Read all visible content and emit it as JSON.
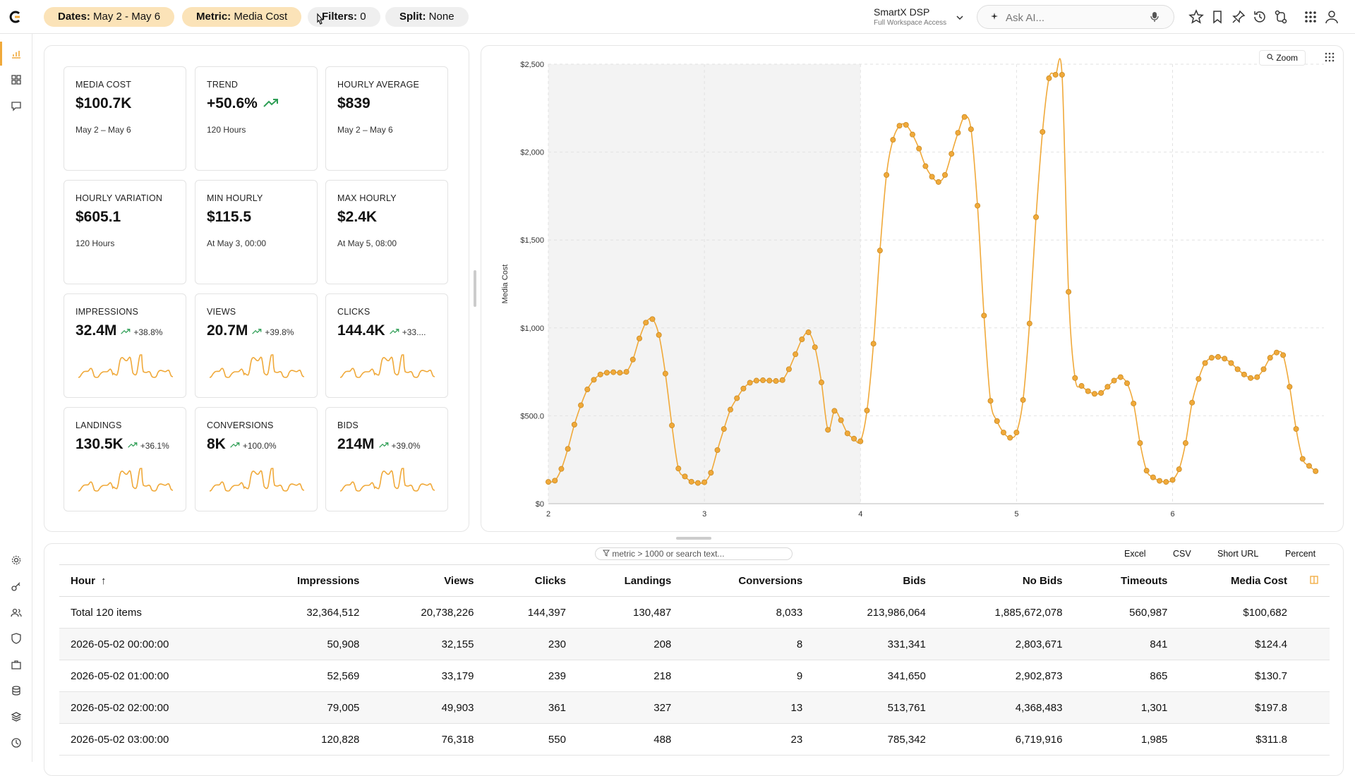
{
  "toolbar": {
    "dates_label": "Dates:",
    "dates_value": "May 2 - May 6",
    "metric_label": "Metric:",
    "metric_value": "Media Cost",
    "filters_label": "Filters:",
    "filters_value": "0",
    "split_label": "Split:",
    "split_value": "None"
  },
  "workspace": {
    "name": "SmartX DSP",
    "access": "Full Workspace Access"
  },
  "ask": {
    "placeholder": "Ask AI..."
  },
  "cards": [
    {
      "label": "MEDIA COST",
      "value": "$100.7K",
      "sub": "May 2 – May 6"
    },
    {
      "label": "TREND",
      "value": "+50.6%",
      "sub": "120 Hours"
    },
    {
      "label": "HOURLY AVERAGE",
      "value": "$839",
      "sub": "May 2 – May 6"
    },
    {
      "label": "HOURLY VARIATION",
      "value": "$605.1",
      "sub": "120 Hours"
    },
    {
      "label": "MIN HOURLY",
      "value": "$115.5",
      "sub": "At May 3, 00:00"
    },
    {
      "label": "MAX HOURLY",
      "value": "$2.4K",
      "sub": "At May 5, 08:00"
    },
    {
      "label": "IMPRESSIONS",
      "value": "32.4M",
      "change": "+38.8%"
    },
    {
      "label": "VIEWS",
      "value": "20.7M",
      "change": "+39.8%"
    },
    {
      "label": "CLICKS",
      "value": "144.4K",
      "change": "+33...."
    },
    {
      "label": "LANDINGS",
      "value": "130.5K",
      "change": "+36.1%"
    },
    {
      "label": "CONVERSIONS",
      "value": "8K",
      "change": "+100.0%"
    },
    {
      "label": "BIDS",
      "value": "214M",
      "change": "+39.0%"
    }
  ],
  "chart_zoom": "Zoom",
  "chart_data": {
    "type": "line",
    "ylabel": "Media Cost",
    "ylim": [
      0,
      2500
    ],
    "yticks": [
      "$0",
      "$500.0",
      "$1,000",
      "$1,500",
      "$2,000",
      "$2,500"
    ],
    "xticks": [
      "2",
      "3",
      "4",
      "5",
      "6"
    ],
    "xlim": [
      2,
      6.97
    ],
    "shaded_range": [
      2,
      4
    ],
    "color": "#f0a93a",
    "series": [
      {
        "values": [
          124,
          131,
          198,
          312,
          450,
          560,
          650,
          705,
          735,
          745,
          748,
          745,
          750,
          820,
          940,
          1030,
          1050,
          960,
          740,
          445,
          200,
          155,
          125,
          118,
          122,
          176,
          305,
          425,
          535,
          600,
          655,
          688,
          700,
          702,
          700,
          698,
          703,
          765,
          850,
          935,
          975,
          890,
          690,
          420,
          528,
          475,
          400,
          370,
          355,
          530,
          910,
          1440,
          1870,
          2070,
          2150,
          2155,
          2100,
          2020,
          1920,
          1860,
          1830,
          1870,
          1990,
          2110,
          2200,
          2130,
          1695,
          1070,
          585,
          470,
          405,
          375,
          405,
          590,
          1025,
          1630,
          2115,
          2420,
          2440,
          2440,
          1205,
          715,
          670,
          640,
          625,
          630,
          665,
          700,
          720,
          685,
          570,
          345,
          188,
          150,
          130,
          124,
          135,
          196,
          345,
          575,
          710,
          800,
          830,
          835,
          825,
          800,
          765,
          735,
          715,
          720,
          765,
          830,
          860,
          845,
          665,
          425,
          255,
          215,
          185
        ]
      }
    ]
  },
  "table_tools": {
    "filter_placeholder": "metric > 1000 or search text...",
    "excel": "Excel",
    "csv": "CSV",
    "short_url": "Short URL",
    "percent": "Percent"
  },
  "table": {
    "headers": [
      "Hour",
      "Impressions",
      "Views",
      "Clicks",
      "Landings",
      "Conversions",
      "Bids",
      "No Bids",
      "Timeouts",
      "Media Cost"
    ],
    "sort_arrow": "↑",
    "rows": [
      [
        "Total 120 items",
        "32,364,512",
        "20,738,226",
        "144,397",
        "130,487",
        "8,033",
        "213,986,064",
        "1,885,672,078",
        "560,987",
        "$100,682"
      ],
      [
        "2026-05-02 00:00:00",
        "50,908",
        "32,155",
        "230",
        "208",
        "8",
        "331,341",
        "2,803,671",
        "841",
        "$124.4"
      ],
      [
        "2026-05-02 01:00:00",
        "52,569",
        "33,179",
        "239",
        "218",
        "9",
        "341,650",
        "2,902,873",
        "865",
        "$130.7"
      ],
      [
        "2026-05-02 02:00:00",
        "79,005",
        "49,903",
        "361",
        "327",
        "13",
        "513,761",
        "4,368,483",
        "1,301",
        "$197.8"
      ],
      [
        "2026-05-02 03:00:00",
        "120,828",
        "76,318",
        "550",
        "488",
        "23",
        "785,342",
        "6,719,916",
        "1,985",
        "$311.8"
      ]
    ]
  }
}
